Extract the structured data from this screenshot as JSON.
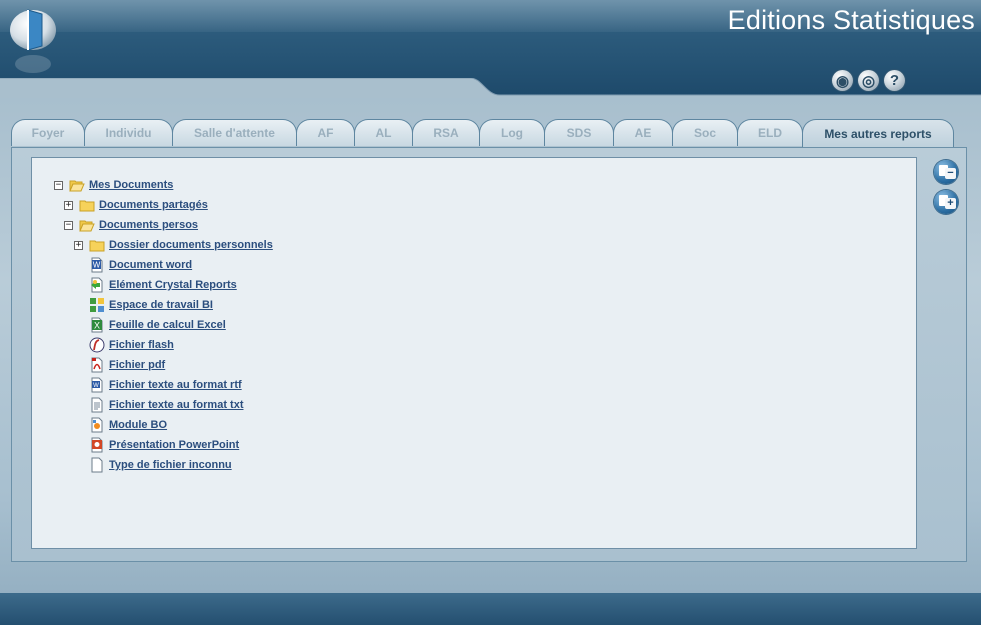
{
  "header": {
    "app_title": "Editions Statistiques"
  },
  "header_icons": [
    {
      "name": "eye-icon",
      "glyph": "◉"
    },
    {
      "name": "headset-icon",
      "glyph": "◎"
    },
    {
      "name": "help-icon",
      "glyph": "?"
    }
  ],
  "tabs": [
    {
      "label": "Foyer",
      "active": false
    },
    {
      "label": "Individu",
      "active": false
    },
    {
      "label": "Salle d'attente",
      "active": false
    },
    {
      "label": "AF",
      "active": false
    },
    {
      "label": "AL",
      "active": false
    },
    {
      "label": "RSA",
      "active": false
    },
    {
      "label": "Log",
      "active": false
    },
    {
      "label": "SDS",
      "active": false
    },
    {
      "label": "AE",
      "active": false
    },
    {
      "label": "Soc",
      "active": false
    },
    {
      "label": "ELD",
      "active": false
    },
    {
      "label": "Mes autres reports",
      "active": true
    }
  ],
  "side_buttons": [
    {
      "name": "collapse-all-button",
      "sign": "−"
    },
    {
      "name": "expand-all-button",
      "sign": "+"
    }
  ],
  "tree": [
    {
      "label": "Mes Documents",
      "icon": "folder-open-icon",
      "toggle": "−"
    },
    {
      "label": "Documents partagés",
      "icon": "folder-icon",
      "toggle": "+"
    },
    {
      "label": "Documents persos",
      "icon": "folder-open-icon",
      "toggle": "−"
    },
    {
      "label": "Dossier documents personnels",
      "icon": "folder-icon",
      "toggle": "+"
    },
    {
      "label": "Document word",
      "icon": "word-icon",
      "toggle": ""
    },
    {
      "label": "Elément Crystal Reports",
      "icon": "crystal-reports-icon",
      "toggle": ""
    },
    {
      "label": "Espace de travail BI",
      "icon": "bi-workspace-icon",
      "toggle": ""
    },
    {
      "label": "Feuille de calcul Excel",
      "icon": "excel-icon",
      "toggle": ""
    },
    {
      "label": "Fichier flash",
      "icon": "flash-icon",
      "toggle": ""
    },
    {
      "label": "Fichier pdf",
      "icon": "pdf-icon",
      "toggle": ""
    },
    {
      "label": "Fichier texte au format rtf",
      "icon": "rtf-icon",
      "toggle": ""
    },
    {
      "label": "Fichier texte au format txt",
      "icon": "txt-icon",
      "toggle": ""
    },
    {
      "label": "Module BO",
      "icon": "bo-module-icon",
      "toggle": ""
    },
    {
      "label": "Présentation PowerPoint",
      "icon": "powerpoint-icon",
      "toggle": ""
    },
    {
      "label": "Type de fichier inconnu",
      "icon": "unknown-file-icon",
      "toggle": ""
    }
  ],
  "colors": {
    "header_dark": "#1e4a6b",
    "accent_link": "#2b4e7e",
    "content_bg": "#e9eff3"
  }
}
